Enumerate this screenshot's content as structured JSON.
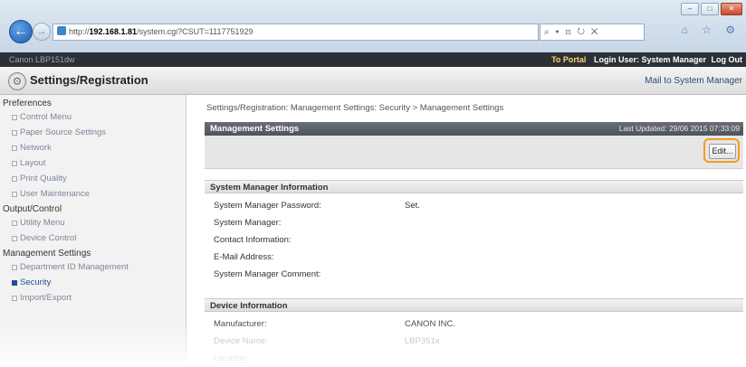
{
  "browser": {
    "url_prefix": "http://",
    "url_host": "192.168.1.81",
    "url_path": "/system.cgi?CSUT=1117751929",
    "addr_actions": "⌕ ▾ ⊡ ↻ ✕",
    "tab_icons": "⌂ ☆ ⚙"
  },
  "portal": {
    "device_label": "Canon LBP151dw",
    "to_portal": "To Portal",
    "login_user": "Login User: System Manager",
    "logout": "Log Out"
  },
  "header": {
    "title": "Settings/Registration",
    "mail": "Mail to System Manager"
  },
  "sidebar": {
    "groups": [
      {
        "label": "Preferences",
        "items": [
          "Control Menu",
          "Paper Source Settings",
          "Network",
          "Layout",
          "Print Quality",
          "User Maintenance"
        ]
      },
      {
        "label": "Output/Control",
        "items": [
          "Utility Menu",
          "Device Control"
        ]
      },
      {
        "label": "Management Settings",
        "items": [
          "Department ID Management",
          "Security",
          "Import/Export"
        ]
      }
    ],
    "active_item": "Security"
  },
  "main": {
    "breadcrumb": "Settings/Registration: Management Settings: Security > Management Settings",
    "section_title": "Management Settings",
    "last_updated": "Last Updated: 29/06 2015 07:33:09",
    "edit_label": "Edit...",
    "system_manager_header": "System Manager Information",
    "system_rows": [
      {
        "label": "System Manager Password:",
        "value": "Set."
      },
      {
        "label": "System Manager:",
        "value": ""
      },
      {
        "label": "Contact Information:",
        "value": ""
      },
      {
        "label": "E-Mail Address:",
        "value": ""
      },
      {
        "label": "System Manager Comment:",
        "value": ""
      }
    ],
    "device_header": "Device Information",
    "device_rows": [
      {
        "label": "Manufacturer:",
        "value": "CANON INC."
      },
      {
        "label": "Device Name:",
        "value": "LBP351x"
      },
      {
        "label": "Location:",
        "value": ""
      }
    ]
  }
}
